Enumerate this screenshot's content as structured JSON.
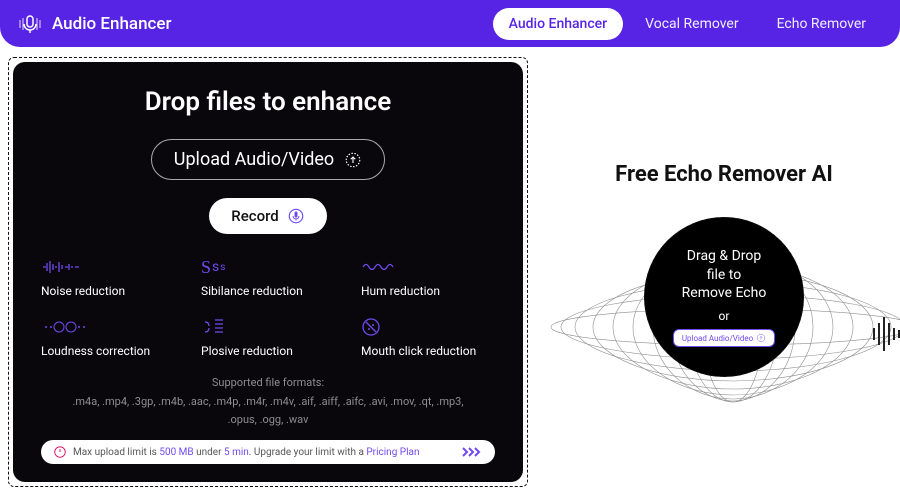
{
  "nav": {
    "brand": "Audio Enhancer",
    "tabs": [
      {
        "label": "Audio Enhancer",
        "active": true
      },
      {
        "label": "Vocal Remover",
        "active": false
      },
      {
        "label": "Echo Remover",
        "active": false
      }
    ]
  },
  "left": {
    "heading": "Drop files to enhance",
    "upload_label": "Upload Audio/Video",
    "record_label": "Record",
    "features": [
      "Noise reduction",
      "Sibilance reduction",
      "Hum reduction",
      "Loudness correction",
      "Plosive reduction",
      "Mouth click reduction"
    ],
    "formats_title": "Supported file formats:",
    "formats": ".m4a, .mp4, .3gp, .m4b, .aac, .m4p, .m4r, .m4v, .aif, .aiff, .aifc, .avi, .mov, .qt, .mp3, .opus, .ogg, .wav",
    "limit_prefix": "Max upload limit is ",
    "limit_size": "500 MB",
    "limit_mid": " under ",
    "limit_time": "5 min",
    "limit_suffix": ". Upgrade your limit with a ",
    "limit_link": "Pricing Plan"
  },
  "right": {
    "title": "Free Echo Remover AI",
    "drop_line1": "Drag & Drop",
    "drop_line2": "file to",
    "drop_line3": "Remove Echo",
    "or": "or",
    "upload_label": "Upload Audio/Video"
  }
}
